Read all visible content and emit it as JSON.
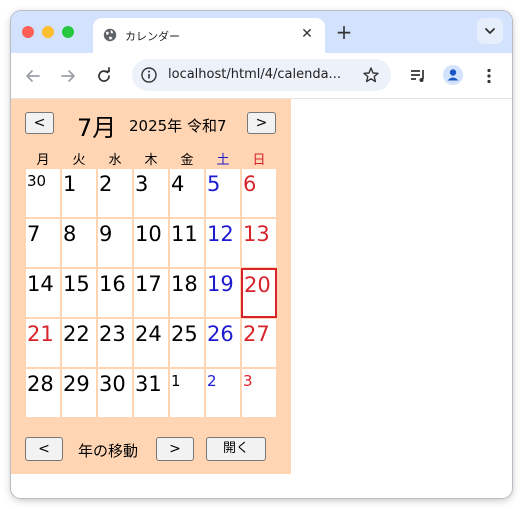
{
  "browser": {
    "tab_title": "カレンダー",
    "tab_close": "✕",
    "new_tab": "+",
    "url": "localhost/html/4/calenda..."
  },
  "calendar": {
    "prev_button": "<",
    "next_button": ">",
    "month_label": "7月",
    "year_label": "2025年 令和7",
    "weekdays": [
      "月",
      "火",
      "水",
      "木",
      "金",
      "土",
      "日"
    ],
    "weeks": [
      [
        "30",
        "1",
        "2",
        "3",
        "4",
        "5",
        "6"
      ],
      [
        "7",
        "8",
        "9",
        "10",
        "11",
        "12",
        "13"
      ],
      [
        "14",
        "15",
        "16",
        "17",
        "18",
        "19",
        "20"
      ],
      [
        "21",
        "22",
        "23",
        "24",
        "25",
        "26",
        "27"
      ],
      [
        "28",
        "29",
        "30",
        "31",
        "1",
        "2",
        "3"
      ]
    ],
    "today": "20",
    "holiday": "21",
    "colors": {
      "saturday": "#1d1ad0",
      "sunday": "#d8232a",
      "panel": "#ffd5b3",
      "today_border": "#d8232a"
    }
  },
  "year_nav": {
    "prev_button": "<",
    "label": "年の移動",
    "next_button": ">",
    "open_button": "開く"
  }
}
